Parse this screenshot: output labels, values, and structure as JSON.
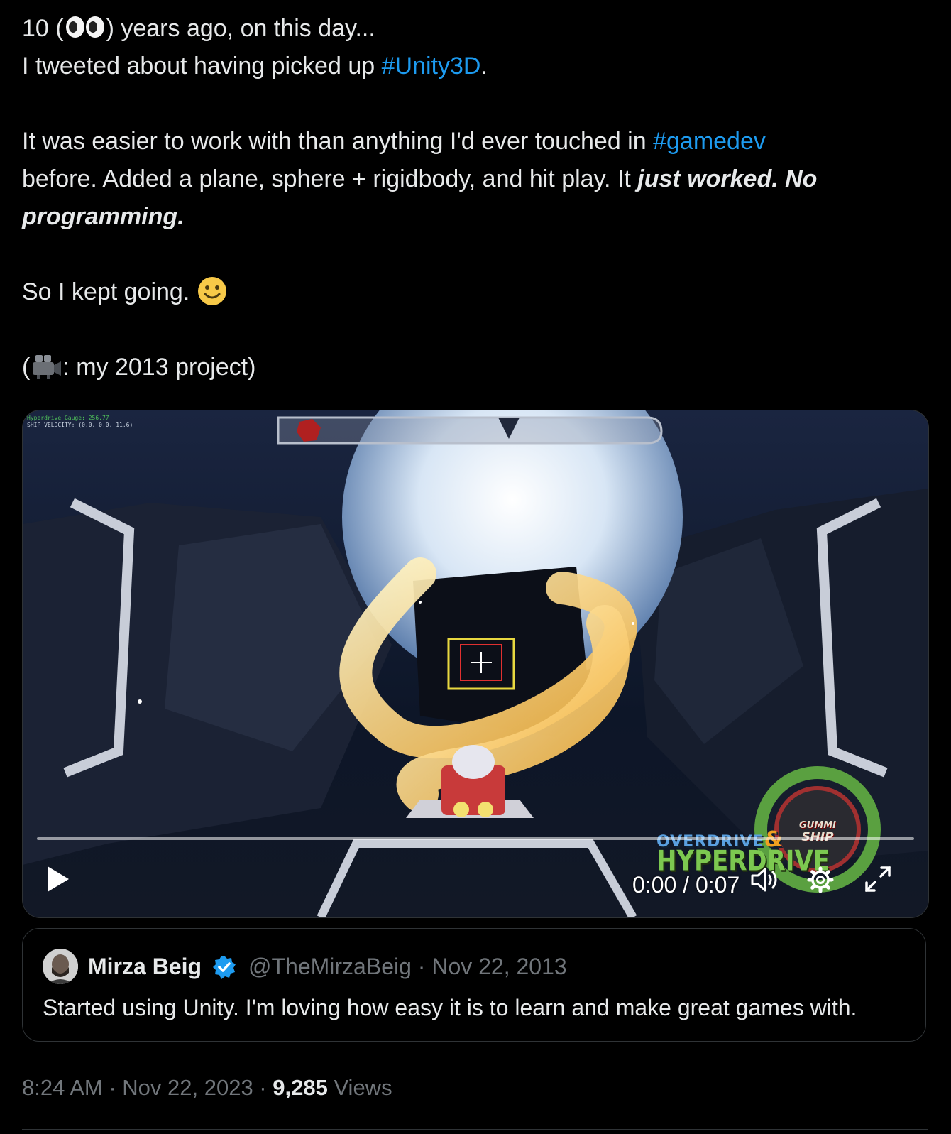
{
  "tweet": {
    "line1_pre": "10 (",
    "line1_post": ") years ago, on this day...",
    "line2_pre": "I tweeted about having picked up ",
    "hashtag_unity": "#Unity3D",
    "line2_post": ".",
    "line3_pre": "It was easier to work with than anything I'd ever touched in ",
    "hashtag_gamedev": "#gamedev",
    "line4_pre": "before. Added a plane, sphere + rigidbody, and hit play. It ",
    "line4_bold": "just worked. No",
    "line5_bold": "programming.",
    "line6": "So I kept going. ",
    "line7_pre": "(",
    "line7_post": ": my 2013 project)"
  },
  "video": {
    "hud_line1": "Hyperdrive Gauge: 256.77",
    "hud_line2": "SHIP VELOCITY: (0.0, 0.0, 11.6)",
    "time": "0:00 / 0:07",
    "progress": 0,
    "logo_overdrive": "OVERDRIVE",
    "logo_amp": "&",
    "logo_hyperdrive": "HYPERDRIVE",
    "logo_gummi": "GUMMI",
    "logo_ship": "SHIP",
    "icons": [
      "play-icon",
      "volume-icon",
      "settings-gear-icon",
      "fullscreen-icon"
    ]
  },
  "quote": {
    "name": "Mirza Beig",
    "handle": "@TheMirzaBeig · Nov 22, 2013",
    "text": "Started using Unity. I'm loving how easy it is to learn and make great games with."
  },
  "meta": {
    "time_date": "8:24 AM · Nov 22, 2023 · ",
    "views_count": "9,285",
    "views_label": " Views"
  },
  "colors": {
    "background": "#000000",
    "text": "#e7e9ea",
    "muted": "#71767b",
    "accent": "#1d9bf0",
    "border": "#2f3336"
  }
}
